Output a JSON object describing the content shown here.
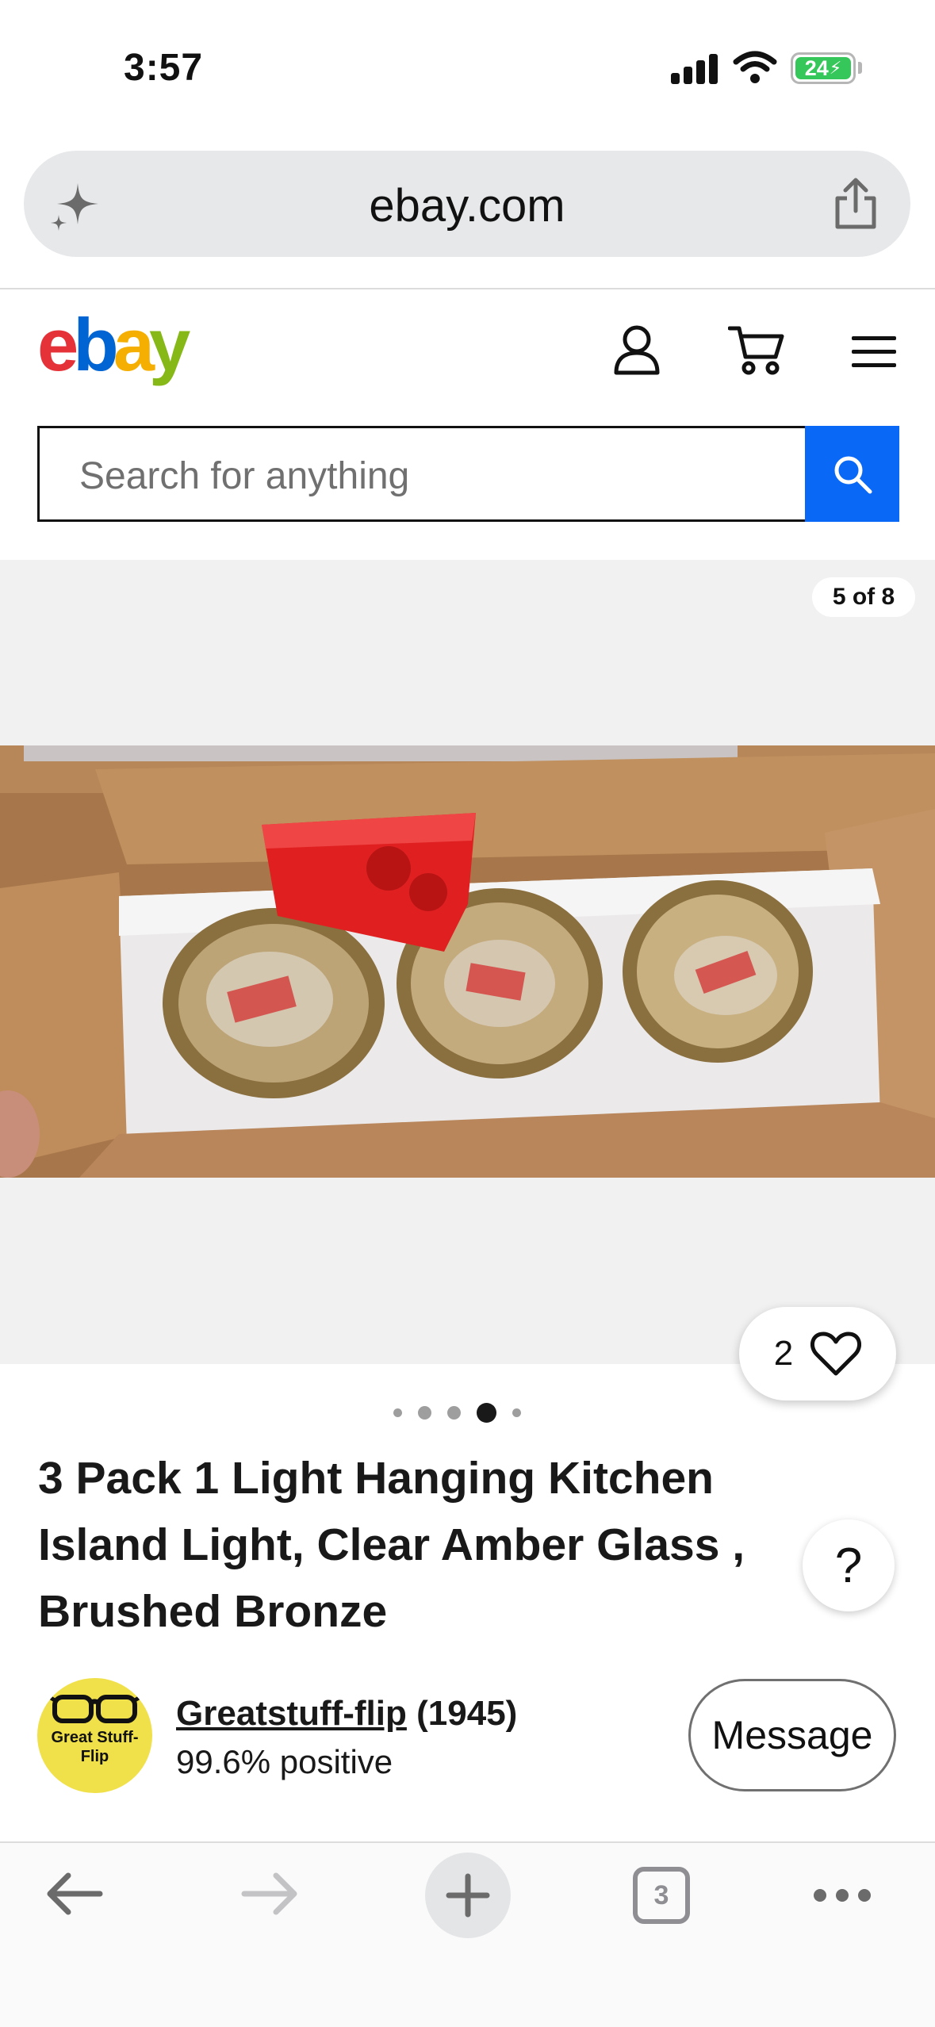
{
  "status_bar": {
    "time": "3:57",
    "battery_level": "24",
    "icons": [
      "cellular-signal-icon",
      "wifi-icon",
      "battery-charging-icon"
    ]
  },
  "browser": {
    "address": "ebay.com",
    "open_tabs_count": "3",
    "toolbar_icons": [
      "back-arrow-icon",
      "forward-arrow-icon",
      "plus-icon",
      "tabs-icon",
      "more-dots-icon"
    ]
  },
  "header": {
    "logo_letters": [
      "e",
      "b",
      "a",
      "y"
    ],
    "logo_colors": [
      "#e53238",
      "#0064d2",
      "#f5af02",
      "#86b817"
    ],
    "icons": [
      "account-icon",
      "cart-icon",
      "hamburger-menu-icon"
    ]
  },
  "search": {
    "placeholder": "Search for anything",
    "button_color": "#0968f6"
  },
  "gallery": {
    "counter": "5 of 8",
    "current_index": 4,
    "dots_visible": 5,
    "watch_count": "2"
  },
  "product": {
    "title_lines": [
      "3 Pack 1 Light Hanging Kitchen",
      "Island Light, Clear Amber Glass ,",
      "Brushed Bronze"
    ],
    "help_label": "?"
  },
  "seller": {
    "avatar_text_lines": [
      "Great Stuff-",
      "Flip"
    ],
    "name": "Greatstuff-flip",
    "feedback_count": "(1945)",
    "positive": "99.6% positive",
    "message_label": "Message"
  }
}
